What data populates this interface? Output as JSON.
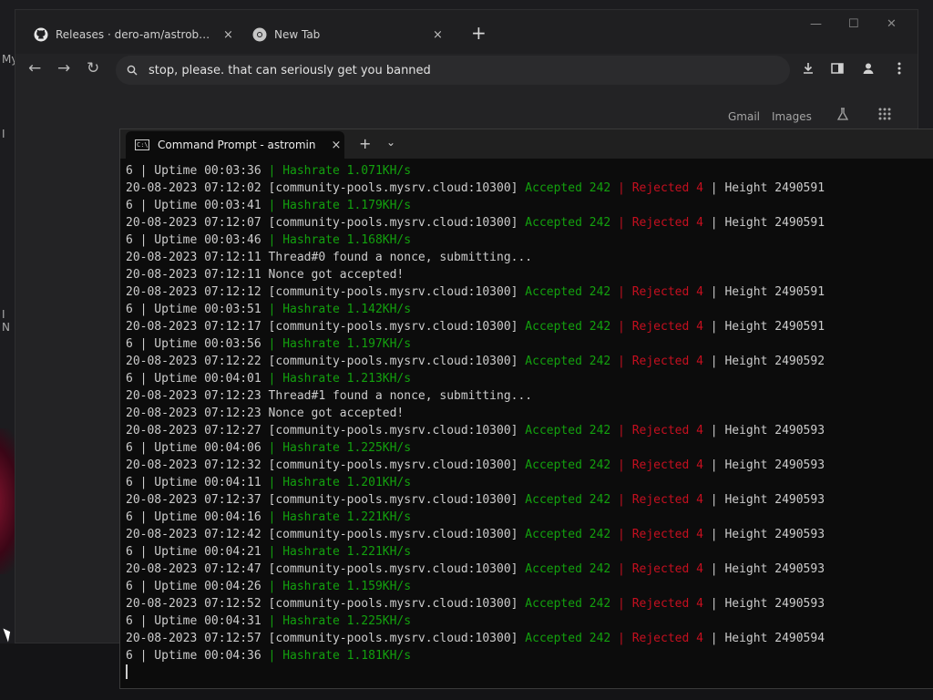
{
  "desktop": {
    "edge_texts": [
      "My",
      "I",
      "I",
      "N"
    ]
  },
  "browser": {
    "tabs": [
      {
        "label": "Releases · dero-am/astrobwt-mi",
        "close": "×"
      },
      {
        "label": "New Tab",
        "close": "×"
      }
    ],
    "new_tab": "+",
    "window_controls": [
      "—",
      "☐",
      "✕"
    ],
    "nav": {
      "back": "←",
      "forward": "→",
      "reload": "↻"
    },
    "omnibox": {
      "value": "stop, please. that can seriously get you banned"
    },
    "toolbar_icons": [
      "download-icon",
      "sidebar-icon",
      "profile-icon",
      "menu-icon"
    ],
    "gbar": {
      "gmail": "Gmail",
      "images": "Images"
    }
  },
  "terminal": {
    "tab_title": "Command Prompt - astromin",
    "tab_close": "×",
    "new_tab": "+",
    "dropdown": "⌄",
    "colors": {
      "accepted": "#13a10e",
      "rejected": "#c50f1f",
      "text": "#cccccc"
    },
    "lines": [
      [
        {
          "t": "6 | Uptime 00:03:36 "
        },
        {
          "t": "| Hashrate 1.071KH/s",
          "c": "green"
        }
      ],
      [
        {
          "t": "20-08-2023 07:12:02 [community-pools.mysrv.cloud:10300] "
        },
        {
          "t": "Accepted 242 ",
          "c": "green"
        },
        {
          "t": "| Rejected 4 ",
          "c": "red"
        },
        {
          "t": "| Height 2490591"
        }
      ],
      [
        {
          "t": "6 | Uptime 00:03:41 "
        },
        {
          "t": "| Hashrate 1.179KH/s",
          "c": "green"
        }
      ],
      [
        {
          "t": "20-08-2023 07:12:07 [community-pools.mysrv.cloud:10300] "
        },
        {
          "t": "Accepted 242 ",
          "c": "green"
        },
        {
          "t": "| Rejected 4 ",
          "c": "red"
        },
        {
          "t": "| Height 2490591"
        }
      ],
      [
        {
          "t": "6 | Uptime 00:03:46 "
        },
        {
          "t": "| Hashrate 1.168KH/s",
          "c": "green"
        }
      ],
      [
        {
          "t": "20-08-2023 07:12:11 Thread#0 found a nonce, submitting..."
        }
      ],
      [
        {
          "t": "20-08-2023 07:12:11 Nonce got accepted!"
        }
      ],
      [
        {
          "t": "20-08-2023 07:12:12 [community-pools.mysrv.cloud:10300] "
        },
        {
          "t": "Accepted 242 ",
          "c": "green"
        },
        {
          "t": "| Rejected 4 ",
          "c": "red"
        },
        {
          "t": "| Height 2490591"
        }
      ],
      [
        {
          "t": "6 | Uptime 00:03:51 "
        },
        {
          "t": "| Hashrate 1.142KH/s",
          "c": "green"
        }
      ],
      [
        {
          "t": "20-08-2023 07:12:17 [community-pools.mysrv.cloud:10300] "
        },
        {
          "t": "Accepted 242 ",
          "c": "green"
        },
        {
          "t": "| Rejected 4 ",
          "c": "red"
        },
        {
          "t": "| Height 2490591"
        }
      ],
      [
        {
          "t": "6 | Uptime 00:03:56 "
        },
        {
          "t": "| Hashrate 1.197KH/s",
          "c": "green"
        }
      ],
      [
        {
          "t": "20-08-2023 07:12:22 [community-pools.mysrv.cloud:10300] "
        },
        {
          "t": "Accepted 242 ",
          "c": "green"
        },
        {
          "t": "| Rejected 4 ",
          "c": "red"
        },
        {
          "t": "| Height 2490592"
        }
      ],
      [
        {
          "t": "6 | Uptime 00:04:01 "
        },
        {
          "t": "| Hashrate 1.213KH/s",
          "c": "green"
        }
      ],
      [
        {
          "t": "20-08-2023 07:12:23 Thread#1 found a nonce, submitting..."
        }
      ],
      [
        {
          "t": "20-08-2023 07:12:23 Nonce got accepted!"
        }
      ],
      [
        {
          "t": "20-08-2023 07:12:27 [community-pools.mysrv.cloud:10300] "
        },
        {
          "t": "Accepted 242 ",
          "c": "green"
        },
        {
          "t": "| Rejected 4 ",
          "c": "red"
        },
        {
          "t": "| Height 2490593"
        }
      ],
      [
        {
          "t": "6 | Uptime 00:04:06 "
        },
        {
          "t": "| Hashrate 1.225KH/s",
          "c": "green"
        }
      ],
      [
        {
          "t": "20-08-2023 07:12:32 [community-pools.mysrv.cloud:10300] "
        },
        {
          "t": "Accepted 242 ",
          "c": "green"
        },
        {
          "t": "| Rejected 4 ",
          "c": "red"
        },
        {
          "t": "| Height 2490593"
        }
      ],
      [
        {
          "t": "6 | Uptime 00:04:11 "
        },
        {
          "t": "| Hashrate 1.201KH/s",
          "c": "green"
        }
      ],
      [
        {
          "t": "20-08-2023 07:12:37 [community-pools.mysrv.cloud:10300] "
        },
        {
          "t": "Accepted 242 ",
          "c": "green"
        },
        {
          "t": "| Rejected 4 ",
          "c": "red"
        },
        {
          "t": "| Height 2490593"
        }
      ],
      [
        {
          "t": "6 | Uptime 00:04:16 "
        },
        {
          "t": "| Hashrate 1.221KH/s",
          "c": "green"
        }
      ],
      [
        {
          "t": "20-08-2023 07:12:42 [community-pools.mysrv.cloud:10300] "
        },
        {
          "t": "Accepted 242 ",
          "c": "green"
        },
        {
          "t": "| Rejected 4 ",
          "c": "red"
        },
        {
          "t": "| Height 2490593"
        }
      ],
      [
        {
          "t": "6 | Uptime 00:04:21 "
        },
        {
          "t": "| Hashrate 1.221KH/s",
          "c": "green"
        }
      ],
      [
        {
          "t": "20-08-2023 07:12:47 [community-pools.mysrv.cloud:10300] "
        },
        {
          "t": "Accepted 242 ",
          "c": "green"
        },
        {
          "t": "| Rejected 4 ",
          "c": "red"
        },
        {
          "t": "| Height 2490593"
        }
      ],
      [
        {
          "t": "6 | Uptime 00:04:26 "
        },
        {
          "t": "| Hashrate 1.159KH/s",
          "c": "green"
        }
      ],
      [
        {
          "t": "20-08-2023 07:12:52 [community-pools.mysrv.cloud:10300] "
        },
        {
          "t": "Accepted 242 ",
          "c": "green"
        },
        {
          "t": "| Rejected 4 ",
          "c": "red"
        },
        {
          "t": "| Height 2490593"
        }
      ],
      [
        {
          "t": "6 | Uptime 00:04:31 "
        },
        {
          "t": "| Hashrate 1.225KH/s",
          "c": "green"
        }
      ],
      [
        {
          "t": "20-08-2023 07:12:57 [community-pools.mysrv.cloud:10300] "
        },
        {
          "t": "Accepted 242 ",
          "c": "green"
        },
        {
          "t": "| Rejected 4 ",
          "c": "red"
        },
        {
          "t": "| Height 2490594"
        }
      ],
      [
        {
          "t": "6 | Uptime 00:04:36 "
        },
        {
          "t": "| Hashrate 1.181KH/s",
          "c": "green"
        }
      ]
    ]
  }
}
